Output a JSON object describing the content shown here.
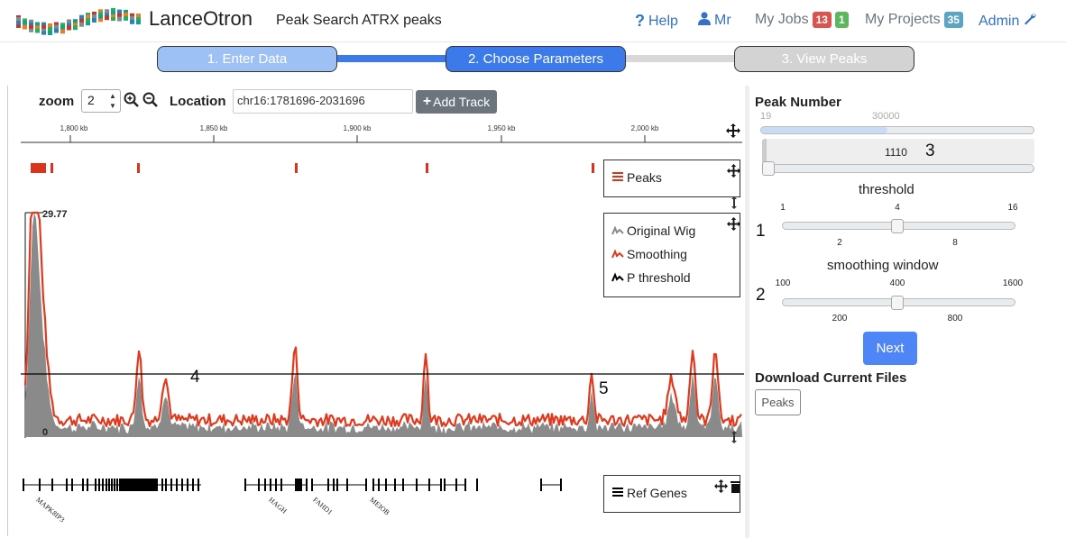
{
  "header": {
    "app_title": "LanceOtron",
    "page_title": "Peak Search ATRX peaks",
    "help_label": "Help",
    "user_label": "Mr",
    "jobs_label": "My Jobs",
    "jobs_badge_red": "13",
    "jobs_badge_green": "1",
    "projects_label": "My Projects",
    "projects_badge": "35",
    "admin_label": "Admin",
    "colors": {
      "link": "#3472c4",
      "badge_red": "#d9534f",
      "badge_green": "#5cb85c",
      "badge_teal": "#5bc0de"
    }
  },
  "steps": [
    {
      "label": "1. Enter Data"
    },
    {
      "label": "2. Choose Parameters"
    },
    {
      "label": "3. View Peaks"
    }
  ],
  "toolbar": {
    "zoom_label": "zoom",
    "zoom_value": "2",
    "location_label": "Location",
    "location_value": "chr16:1781696-2031696",
    "add_track_label": "Add Track"
  },
  "axis": {
    "ticks": [
      "1,800 kb",
      "1,850 kb",
      "1,900 kb",
      "1,950 kb",
      "2,000 kb"
    ]
  },
  "tracks": {
    "peaks_label": "Peaks",
    "signal_max": "29.77",
    "signal_min": "0",
    "legend": [
      "Original Wig",
      "Smoothing",
      "P threshold"
    ],
    "ref_genes_label": "Ref Genes",
    "gene_names": [
      "MAPK8IP3",
      "HAGH",
      "FAHD1",
      "MEIOB"
    ],
    "colors": {
      "signal_gray": "#8a8a8a",
      "smoothing_red": "#e03a1e",
      "threshold_black": "#000000",
      "peak_red": "#d8341e"
    }
  },
  "annotations": [
    "1",
    "2",
    "3",
    "4",
    "5"
  ],
  "right_panel": {
    "peak_number_title": "Peak Number",
    "peak_min": "19",
    "peak_max": "30000",
    "peak_value": "1110",
    "threshold_title": "threshold",
    "threshold_ticks_top": [
      "1",
      "4",
      "16"
    ],
    "threshold_ticks_bottom": [
      "2",
      "8"
    ],
    "smoothing_title": "smoothing window",
    "smoothing_ticks_top": [
      "100",
      "400",
      "1600"
    ],
    "smoothing_ticks_bottom": [
      "200",
      "800"
    ],
    "next_label": "Next",
    "download_title": "Download Current Files",
    "download_peaks_label": "Peaks"
  }
}
